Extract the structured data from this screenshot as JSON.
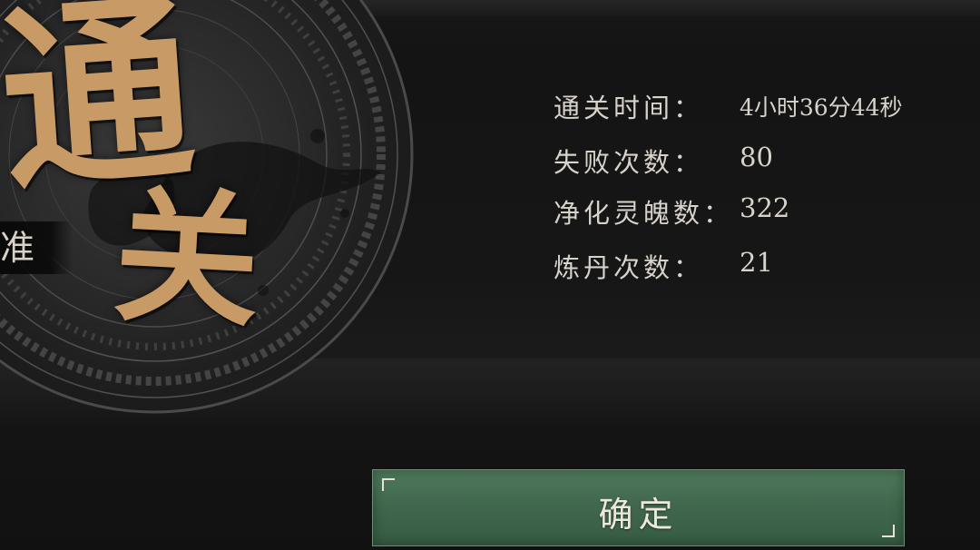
{
  "emblem": {
    "glyph_top": "通",
    "glyph_bottom": "关",
    "side_tag": "准",
    "accent_color": "#c89a66"
  },
  "stats": [
    {
      "label": "通关时间：",
      "value": "4小时36分44秒"
    },
    {
      "label": "失败次数：",
      "value": "80"
    },
    {
      "label": "净化灵魄数：",
      "value": "322"
    },
    {
      "label": "炼丹次数：",
      "value": "21"
    }
  ],
  "confirm_button": {
    "label": "确定",
    "color": "#41684e"
  }
}
